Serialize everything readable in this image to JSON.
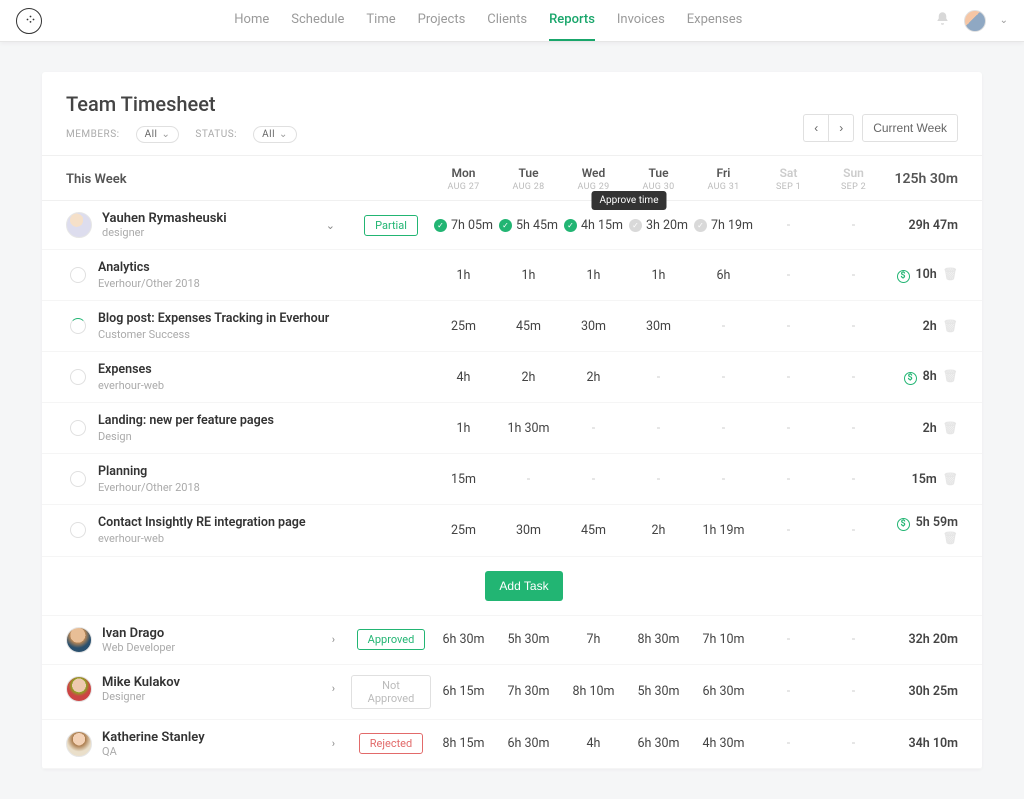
{
  "nav": {
    "items": [
      "Home",
      "Schedule",
      "Time",
      "Projects",
      "Clients",
      "Reports",
      "Invoices",
      "Expenses"
    ],
    "active": "Reports"
  },
  "page": {
    "title": "Team Timesheet",
    "members_label": "MEMBERS:",
    "members_value": "All",
    "status_label": "STATUS:",
    "status_value": "All",
    "current_week": "Current Week",
    "this_week": "This Week",
    "grand_total": "125h 30m",
    "tooltip": "Approve time"
  },
  "columns": [
    {
      "day": "Mon",
      "sub": "AUG 27"
    },
    {
      "day": "Tue",
      "sub": "AUG 28"
    },
    {
      "day": "Wed",
      "sub": "AUG 29"
    },
    {
      "day": "Tue",
      "sub": "AUG 30"
    },
    {
      "day": "Fri",
      "sub": "AUG 31"
    },
    {
      "day": "Sat",
      "sub": "SEP 1",
      "dim": true
    },
    {
      "day": "Sun",
      "sub": "SEP 2",
      "dim": true
    }
  ],
  "expanded_member": {
    "name": "Yauhen Rymasheuski",
    "role": "designer",
    "status": "Partial",
    "cells": [
      {
        "v": "7h 05m",
        "check": true
      },
      {
        "v": "5h 45m",
        "check": true
      },
      {
        "v": "4h 15m",
        "check": true
      },
      {
        "v": "3h 20m",
        "check": false,
        "tooltip": true
      },
      {
        "v": "7h 19m",
        "check": false
      },
      {
        "v": "-",
        "dim": true
      },
      {
        "v": "-",
        "dim": true
      }
    ],
    "total": "29h 47m"
  },
  "tasks": [
    {
      "name": "Analytics",
      "proj": "Everhour/Other 2018",
      "cells": [
        "1h",
        "1h",
        "1h",
        "1h",
        "6h",
        "-",
        "-"
      ],
      "total": "10h",
      "money": true
    },
    {
      "name": "Blog post: Expenses Tracking in Everhour",
      "proj": "Customer Success",
      "spin": true,
      "cells": [
        "25m",
        "45m",
        "30m",
        "30m",
        "-",
        "-",
        "-"
      ],
      "total": "2h"
    },
    {
      "name": "Expenses",
      "proj": "everhour-web",
      "cells": [
        "4h",
        "2h",
        "2h",
        "-",
        "-",
        "-",
        "-"
      ],
      "total": "8h",
      "money": true
    },
    {
      "name": "Landing: new per feature pages",
      "proj": "Design",
      "cells": [
        "1h",
        "1h 30m",
        "-",
        "-",
        "-",
        "-",
        "-"
      ],
      "total": "2h"
    },
    {
      "name": "Planning",
      "proj": "Everhour/Other 2018",
      "cells": [
        "15m",
        "-",
        "-",
        "-",
        "-",
        "-",
        "-"
      ],
      "total": "15m"
    },
    {
      "name": "Contact Insightly RE integration page",
      "proj": "everhour-web",
      "cells": [
        "25m",
        "30m",
        "45m",
        "2h",
        "1h 19m",
        "-",
        "-"
      ],
      "total": "5h 59m",
      "money": true
    }
  ],
  "add_task": "Add Task",
  "members": [
    {
      "name": "Ivan Drago",
      "role": "Web Developer",
      "avatar": "ivan",
      "status": "Approved",
      "status_class": "approved",
      "cells": [
        "6h 30m",
        "5h 30m",
        "7h",
        "8h 30m",
        "7h 10m",
        "-",
        "-"
      ],
      "total": "32h 20m"
    },
    {
      "name": "Mike Kulakov",
      "role": "Designer",
      "avatar": "mike",
      "status": "Not Approved",
      "status_class": "notapproved",
      "cells": [
        "6h 15m",
        "7h 30m",
        "8h 10m",
        "5h 30m",
        "6h 30m",
        "-",
        "-"
      ],
      "total": "30h 25m"
    },
    {
      "name": "Katherine Stanley",
      "role": "QA",
      "avatar": "kat",
      "status": "Rejected",
      "status_class": "rejected",
      "cells": [
        "8h 15m",
        "6h 30m",
        "4h",
        "6h 30m",
        "4h 30m",
        "-",
        "-"
      ],
      "total": "34h 10m"
    }
  ]
}
